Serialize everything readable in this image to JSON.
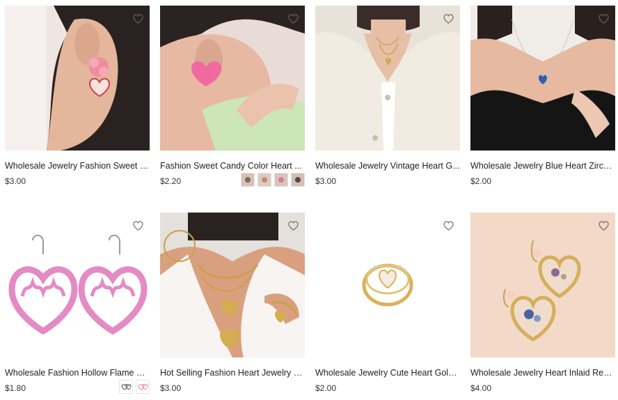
{
  "products": [
    {
      "title": "Wholesale Jewelry Fashion Sweet F...",
      "price": "$3.00",
      "swatch_count": 0,
      "image": "pink-flower-heart-earring-photo"
    },
    {
      "title": "Fashion Sweet Candy Color Heart ...",
      "price": "$2.20",
      "swatch_count": 4,
      "image": "pink-heart-stud-earring-photo"
    },
    {
      "title": "Wholesale Jewelry Vintage Heart G...",
      "price": "$3.00",
      "swatch_count": 0,
      "image": "layered-gold-heart-necklace-photo"
    },
    {
      "title": "Wholesale Jewelry Blue Heart Zirco...",
      "price": "$2.00",
      "swatch_count": 0,
      "image": "blue-heart-zircon-necklace-photo"
    },
    {
      "title": "Wholesale Fashion Hollow Flame H...",
      "price": "$1.80",
      "swatch_count": 2,
      "image": "pink-flame-heart-earrings-photo"
    },
    {
      "title": "Hot Selling Fashion Heart Jewelry Set",
      "price": "$3.00",
      "swatch_count": 0,
      "image": "gold-heart-jewelry-set-photo"
    },
    {
      "title": "Wholesale Jewelry Cute Heart Gold ...",
      "price": "$2.00",
      "swatch_count": 0,
      "image": "gold-heart-ring-photo"
    },
    {
      "title": "Wholesale Jewelry Heart Inlaid Real...",
      "price": "$4.00",
      "swatch_count": 0,
      "image": "dried-flower-heart-earrings-photo"
    }
  ],
  "icons": {
    "favorite": "heart-outline-icon"
  },
  "colors": {
    "text": "#222222",
    "price": "#333333",
    "heart_outline": "#666666"
  }
}
